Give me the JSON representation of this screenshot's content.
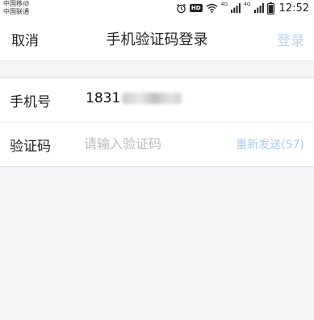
{
  "status_bar": {
    "carrier_1": "中国移动",
    "carrier_2": "中国联通",
    "hd_label": "HD",
    "network_1": "4G",
    "network_2": "4G",
    "time": "12:52"
  },
  "nav": {
    "cancel_label": "取消",
    "title": "手机验证码登录",
    "login_label": "登录"
  },
  "form": {
    "phone_label": "手机号",
    "phone_value_visible": "1831",
    "code_label": "验证码",
    "code_placeholder": "请输入验证码",
    "code_value": "",
    "resend_label": "重新发送(57)"
  },
  "colors": {
    "accent_disabled": "#b9d6f5",
    "page_background": "#f4f4f6"
  }
}
